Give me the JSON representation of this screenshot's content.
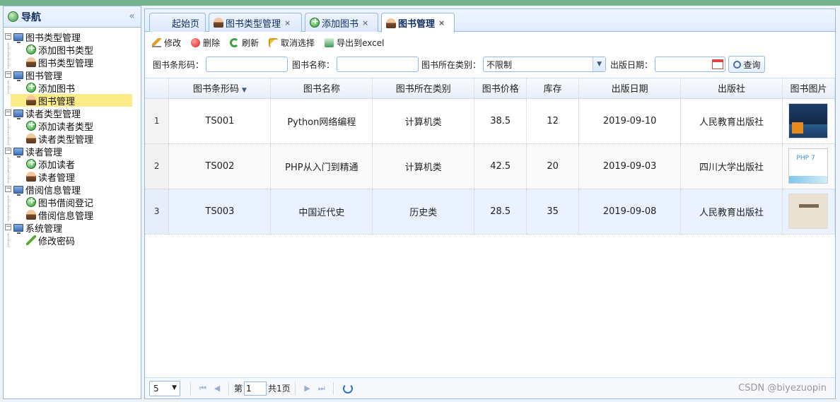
{
  "nav": {
    "title": "导航",
    "collapse_glyph": "«",
    "tree": [
      {
        "label": "图书类型管理",
        "children": [
          "添加图书类型",
          "图书类型管理"
        ]
      },
      {
        "label": "图书管理",
        "children": [
          "添加图书",
          "图书管理"
        ]
      },
      {
        "label": "读者类型管理",
        "children": [
          "添加读者类型",
          "读者类型管理"
        ]
      },
      {
        "label": "读者管理",
        "children": [
          "添加读者",
          "读者管理"
        ]
      },
      {
        "label": "借阅信息管理",
        "children": [
          "图书借阅登记",
          "借阅信息管理"
        ]
      },
      {
        "label": "系统管理",
        "children": [
          "修改密码"
        ]
      }
    ],
    "selected": "图书管理"
  },
  "tabs": [
    {
      "label": "起始页",
      "closable": false
    },
    {
      "label": "图书类型管理",
      "closable": true
    },
    {
      "label": "添加图书",
      "closable": true
    },
    {
      "label": "图书管理",
      "closable": true,
      "active": true
    }
  ],
  "toolbar": {
    "edit": "修改",
    "delete": "删除",
    "refresh": "刷新",
    "unselect": "取消选择",
    "export": "导出到excel"
  },
  "search": {
    "barcode_label": "图书条形码：",
    "barcode_value": "",
    "name_label": "图书名称：",
    "name_value": "",
    "category_label": "图书所在类别：",
    "category_value": "不限制",
    "date_label": "出版日期：",
    "date_value": "",
    "query_button": "查询"
  },
  "grid": {
    "columns": [
      "图书条形码",
      "图书名称",
      "图书所在类别",
      "图书价格",
      "库存",
      "出版日期",
      "出版社",
      "图书图片"
    ],
    "rows": [
      {
        "no": "1",
        "barcode": "TS001",
        "name": "Python网络编程",
        "category": "计算机类",
        "price": "38.5",
        "stock": "12",
        "date": "2019-09-10",
        "publisher": "人民教育出版社",
        "cover": "python-book-cover"
      },
      {
        "no": "2",
        "barcode": "TS002",
        "name": "PHP从入门到精通",
        "category": "计算机类",
        "price": "42.5",
        "stock": "20",
        "date": "2019-09-03",
        "publisher": "四川大学出版社",
        "cover": "php-book-cover",
        "cover_text": "PHP 7"
      },
      {
        "no": "3",
        "barcode": "TS003",
        "name": "中国近代史",
        "category": "历史类",
        "price": "28.5",
        "stock": "35",
        "date": "2019-09-08",
        "publisher": "人民教育出版社",
        "cover": "history-book-cover"
      }
    ]
  },
  "pager": {
    "page_size": "5",
    "page_prefix": "第",
    "page_value": "1",
    "page_suffix": "共1页"
  },
  "watermark": "CSDN @biyezuopin",
  "colors": {
    "topbar": "#76b28f",
    "border": "#95b8e7",
    "selected": "#fbec88"
  }
}
